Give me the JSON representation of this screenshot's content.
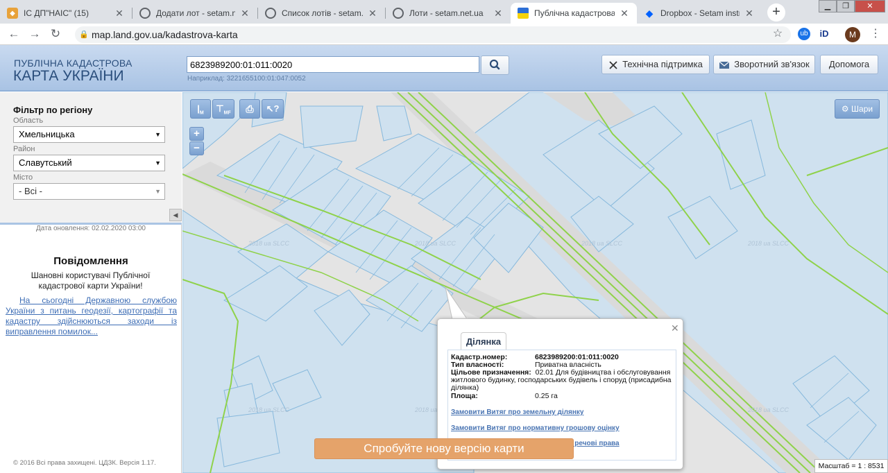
{
  "browser": {
    "tabs": [
      {
        "title": "ІС ДП\"НАІС\" (15)",
        "favicon": "nais-icon",
        "active": false
      },
      {
        "title": "Додати лот - setam.net.u",
        "favicon": "globe-icon",
        "active": false
      },
      {
        "title": "Список лотів - setam.ne",
        "favicon": "globe-icon",
        "active": false
      },
      {
        "title": "Лоти - setam.net.ua",
        "favicon": "globe-icon",
        "active": false
      },
      {
        "title": "Публічна кадастрова ка",
        "favicon": "ukraine-flag-icon",
        "active": true
      },
      {
        "title": "Dropbox - Setam instruc",
        "favicon": "dropbox-icon",
        "active": false
      }
    ],
    "url": "map.land.gov.ua/kadastrova-karta",
    "profile_initial": "M"
  },
  "header": {
    "logo_line1": "ПУБЛІЧНА КАДАСТРОВА",
    "logo_line2": "КАРТА УКРАЇНИ",
    "search_value": "6823989200:01:011:0020",
    "search_example": "Наприклад: 3221655100:01:047:0052",
    "buttons": {
      "support": "Технічна підтримка",
      "feedback": "Зворотний зв'язок",
      "help": "Допомога"
    }
  },
  "sidebar": {
    "filter_title": "Фільтр по регіону",
    "oblast_label": "Область",
    "oblast_value": "Хмельницька",
    "rayon_label": "Район",
    "rayon_value": "Славутський",
    "city_label": "Місто",
    "city_value": "- Всі -",
    "update_date": "Дата оновлення: 02.02.2020 03:00",
    "notice_title": "Повідомлення",
    "notice_text": "Шановні користувачі Публічної кадастрової карти України!",
    "notice_link": "На сьогодні Державною службою України з питань геодезії, картографії та кадастру здійснюються заходи із виправлення помилок...",
    "footer": "© 2016 Всі права захищені. ЦДЗК. Версія 1.17."
  },
  "map": {
    "tools": [
      "М",
      "МF"
    ],
    "zoom_in": "+",
    "zoom_out": "−",
    "layers_label": "Шари",
    "watermark": "2018 ua SLCC",
    "scale": "Масштаб = 1 : 8531",
    "new_version": "Спробуйте нову версію карти",
    "colors": {
      "parcel_fill": "#cfe1ef",
      "parcel_stroke": "#86b8dc",
      "boundary": "#8fd24a",
      "road": "#d8d8d8"
    }
  },
  "popup": {
    "tab": "Ділянка",
    "fields": [
      {
        "label": "Кадастр.номер:",
        "value": "6823989200:01:011:0020"
      },
      {
        "label": "Тип власності:",
        "value": "Приватна власність"
      },
      {
        "label": "Цільове призначення:",
        "value": "02.01 Для будівництва і обслуговування житлового будинку, господарських будівель і споруд (присадибна ділянка)"
      },
      {
        "label": "Площа:",
        "value": "0.25 га"
      }
    ],
    "links": [
      "Замовити Витяг про земельну ділянку",
      "Замовити Витяг про нормативну грошову оцінку",
      "Інформація про право власності та речові права"
    ]
  }
}
